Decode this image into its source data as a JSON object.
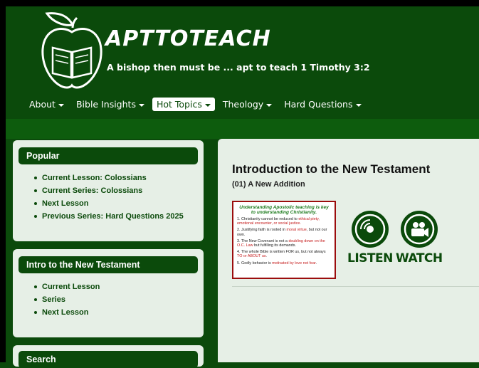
{
  "header": {
    "site_title": "APTTOTEACH",
    "tagline": "A bishop then must be ... apt to teach  1 Timothy 3:2"
  },
  "nav": {
    "items": [
      {
        "label": "About"
      },
      {
        "label": "Bible Insights"
      },
      {
        "label": "Hot Topics",
        "active": true
      },
      {
        "label": "Theology"
      },
      {
        "label": "Hard Questions"
      }
    ]
  },
  "sidebar": {
    "popular": {
      "title": "Popular",
      "links": [
        "Current Lesson: Colossians",
        "Current Series: Colossians",
        "Next Lesson",
        "Previous Series: Hard Questions 2025"
      ]
    },
    "intro": {
      "title": "Intro to the New Testament",
      "links": [
        "Current Lesson",
        "Series",
        "Next Lesson"
      ]
    },
    "search": {
      "title": "Search"
    }
  },
  "main": {
    "title": "Introduction to the New Testament",
    "subtitle": "(01) A New Addition",
    "lesson_image": {
      "heading": "Understanding Apostolic teaching is key to understanding Christianity.",
      "points": [
        {
          "n": "1.",
          "a": "Christianity cannot be reduced to ",
          "b": "ethical piety, emotional encounter, or social justice."
        },
        {
          "n": "2.",
          "a": "Justifying faith is rooted in ",
          "b": "moral virtue",
          "c": ", but not our own."
        },
        {
          "n": "3.",
          "a": "The New Covenant is not a ",
          "b": "doubling down on the O.C. Law",
          "c": " but fulfilling its demands."
        },
        {
          "n": "4.",
          "a": "The whole Bible is written FOR us, but not always ",
          "b": "TO or ABOUT us",
          "c": "."
        },
        {
          "n": "5.",
          "a": "Godly behavior is ",
          "b": "motivated by love not fear",
          "c": "."
        }
      ]
    },
    "listen_label": "LISTEN",
    "watch_label": "WATCH"
  },
  "colors": {
    "brand_green": "#0b4a0b",
    "panel_bg": "#e6efe6",
    "accent_red": "#c41a1a"
  }
}
